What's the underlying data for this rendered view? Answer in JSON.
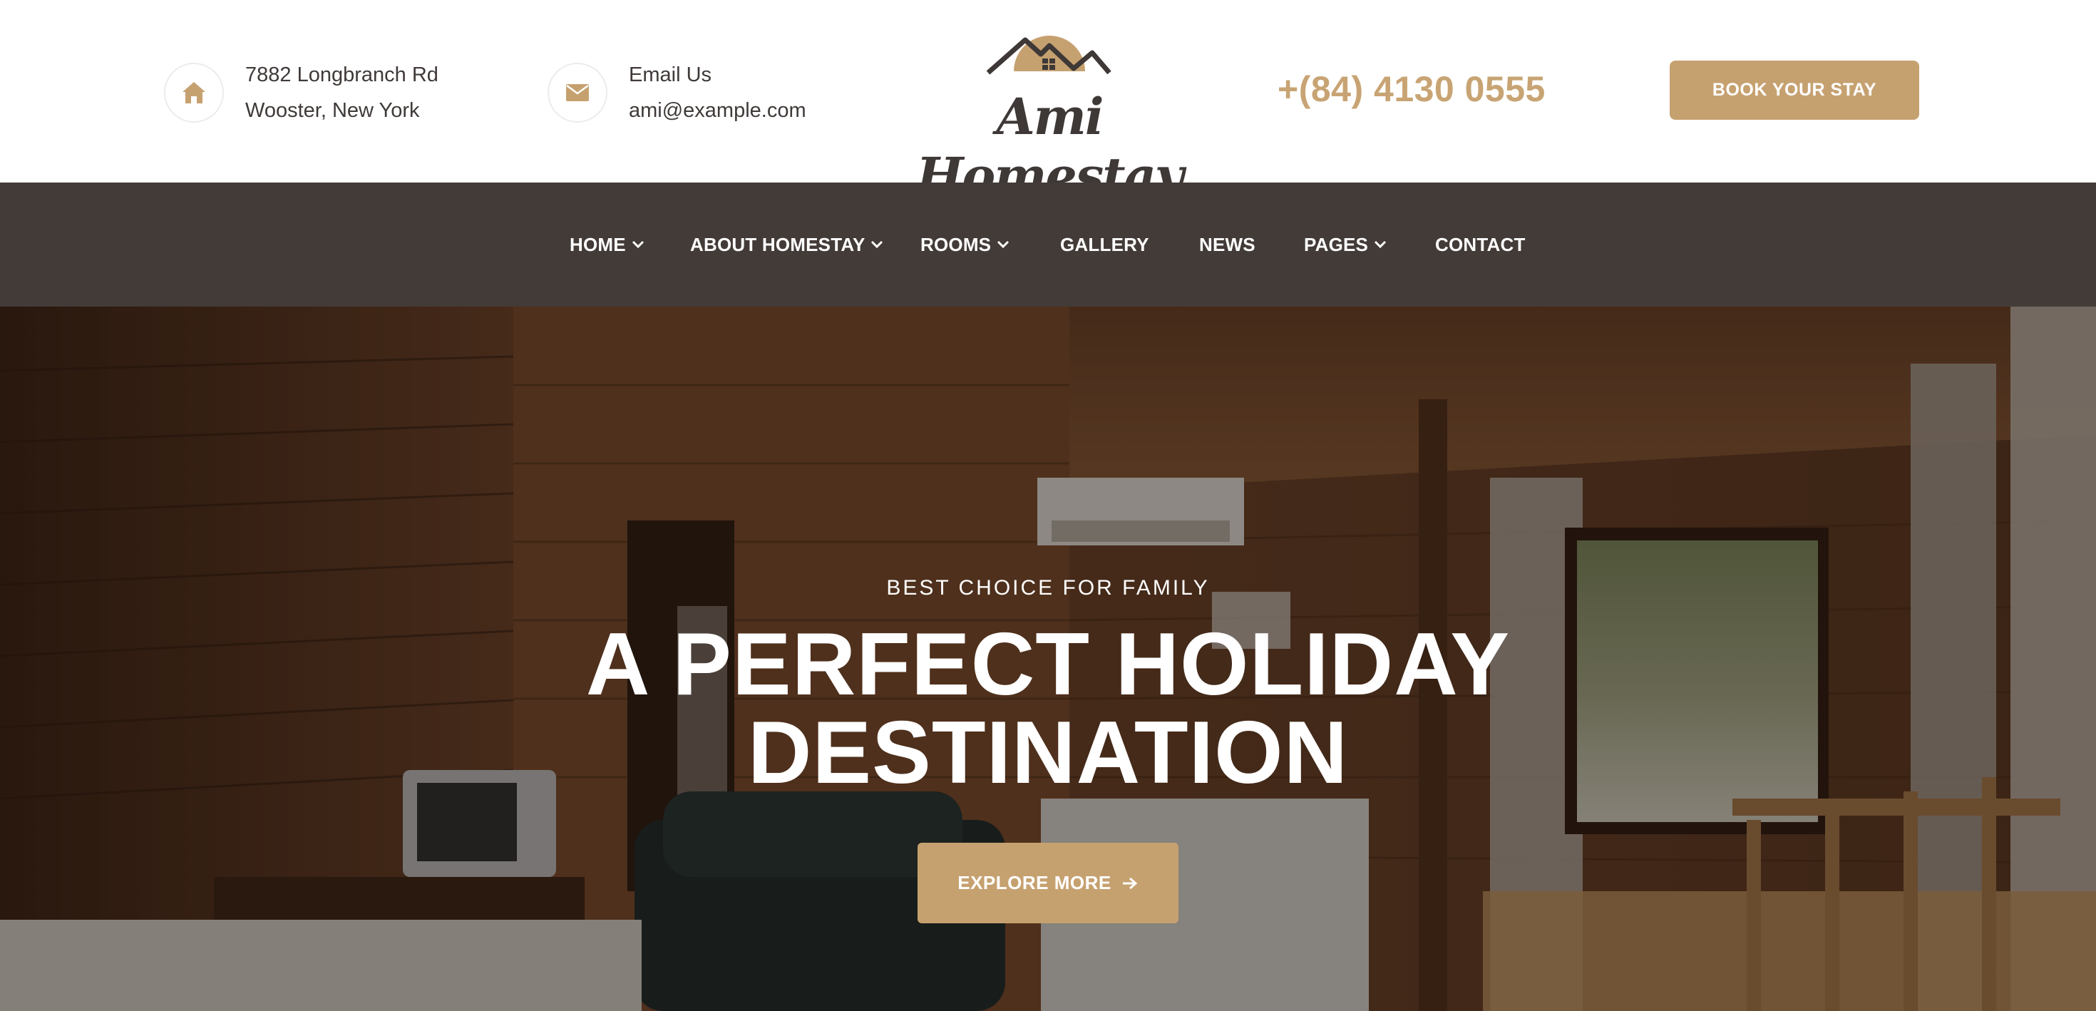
{
  "header": {
    "address": {
      "line1": "7882 Longbranch Rd",
      "line2": "Wooster, New York",
      "icon": "home-icon"
    },
    "email": {
      "label": "Email Us",
      "value": "ami@example.com",
      "icon": "envelope-icon"
    },
    "logo": {
      "text": "Ami Homestay"
    },
    "phone": "+(84) 4130 0555",
    "book_button": "BOOK YOUR STAY"
  },
  "nav": {
    "items": [
      {
        "label": "HOME",
        "has_dropdown": true
      },
      {
        "label": "ABOUT HOMESTAY",
        "has_dropdown": true
      },
      {
        "label": "ROOMS",
        "has_dropdown": true
      },
      {
        "label": "GALLERY",
        "has_dropdown": false
      },
      {
        "label": "NEWS",
        "has_dropdown": false
      },
      {
        "label": "PAGES",
        "has_dropdown": true
      },
      {
        "label": "CONTACT",
        "has_dropdown": false
      }
    ]
  },
  "hero": {
    "eyebrow": "BEST CHOICE FOR FAMILY",
    "title_line1": "A PERFECT HOLIDAY",
    "title_line2": "DESTINATION",
    "button": "EXPLORE MORE"
  },
  "colors": {
    "accent": "#c6a170",
    "nav_bg": "#433b38",
    "text_dark": "#3f3a38"
  }
}
